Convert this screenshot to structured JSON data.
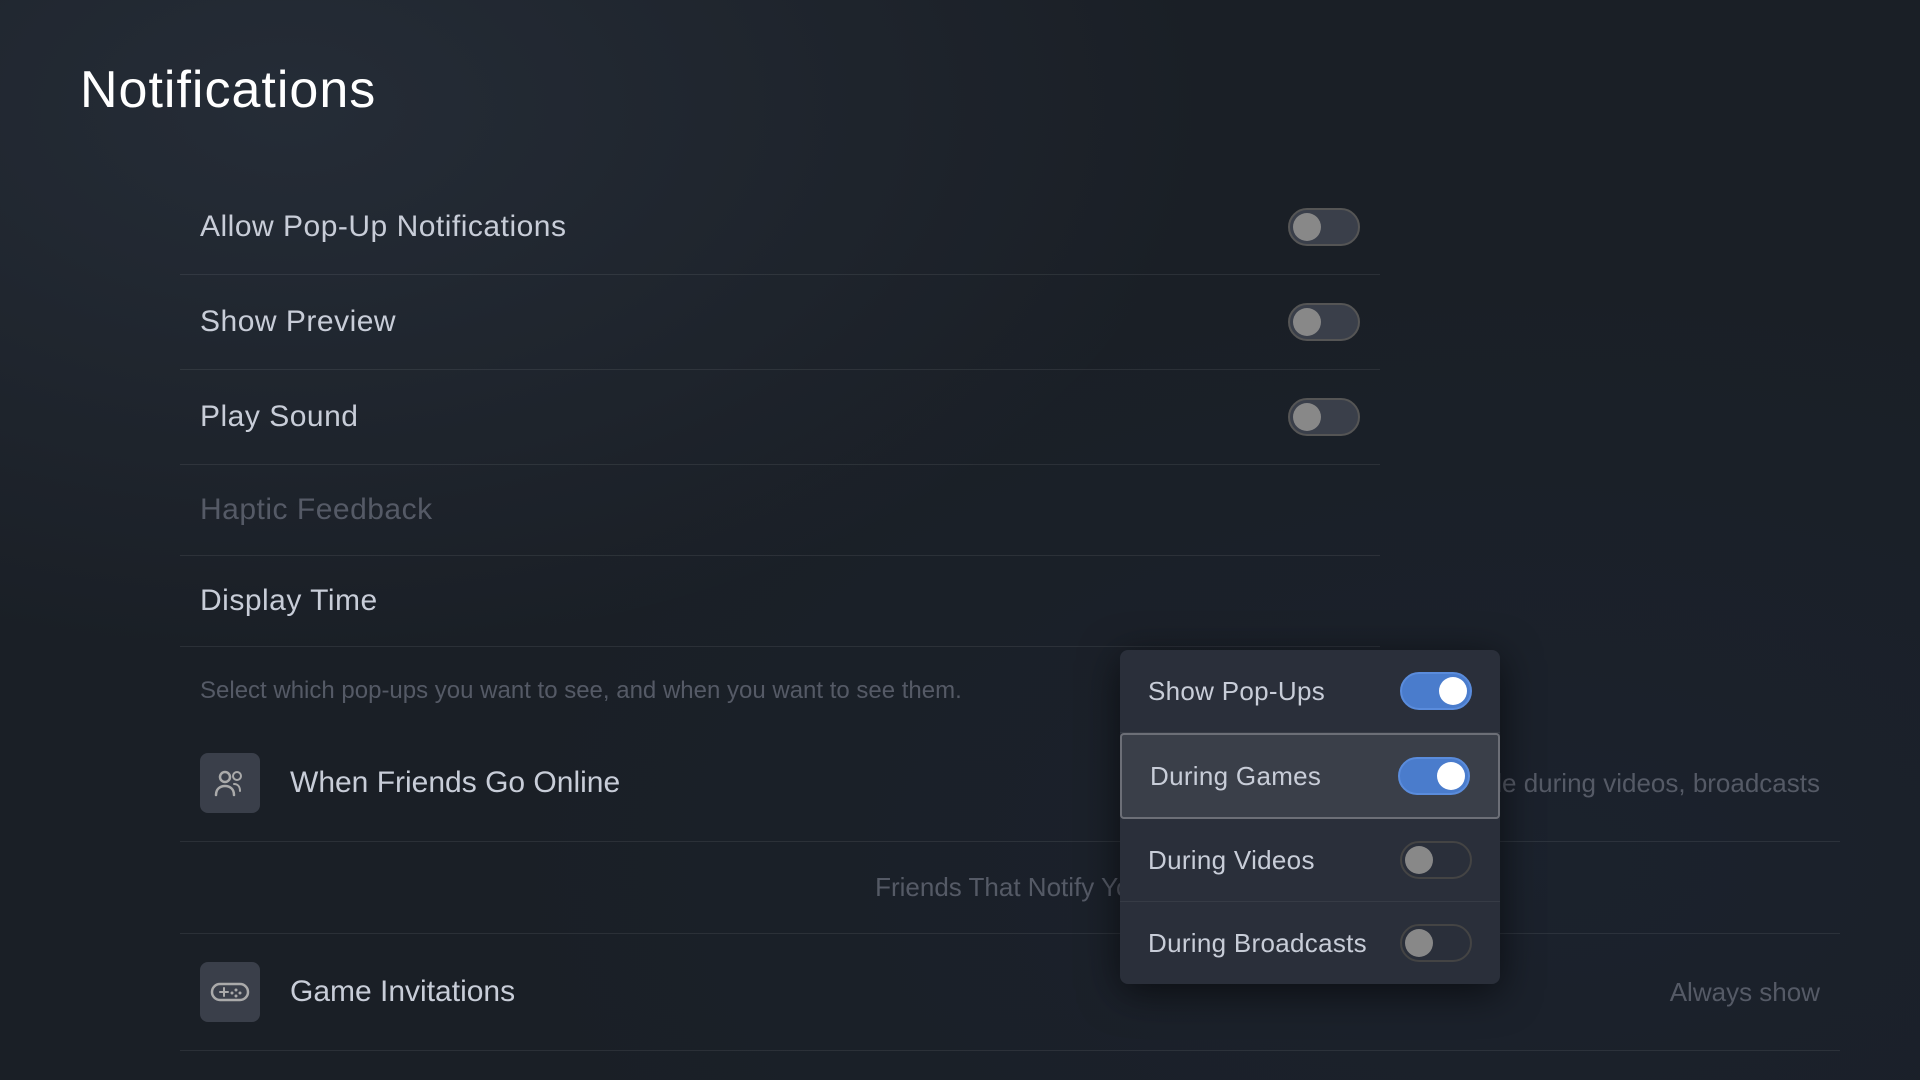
{
  "page": {
    "title": "Notifications"
  },
  "settings": [
    {
      "id": "allow-popups",
      "label": "Allow Pop-Up Notifications",
      "toggle_state": "off",
      "dimmed": false
    },
    {
      "id": "show-preview",
      "label": "Show Preview",
      "toggle_state": "off",
      "dimmed": false
    },
    {
      "id": "play-sound",
      "label": "Play Sound",
      "toggle_state": "off",
      "dimmed": false
    },
    {
      "id": "haptic-feedback",
      "label": "Haptic Feedback",
      "toggle_state": "off",
      "dimmed": true
    },
    {
      "id": "display-time",
      "label": "Display Time",
      "toggle_state": null,
      "dimmed": false
    }
  ],
  "dropdown": {
    "items": [
      {
        "id": "show-popups",
        "label": "Show Pop-Ups",
        "toggle_state": "on",
        "selected": false
      },
      {
        "id": "during-games",
        "label": "During Games",
        "toggle_state": "on",
        "selected": true
      },
      {
        "id": "during-videos",
        "label": "During Videos",
        "toggle_state": "off",
        "selected": false
      },
      {
        "id": "during-broadcasts",
        "label": "During Broadcasts",
        "toggle_state": "off",
        "selected": false
      }
    ]
  },
  "info_text": "Select which pop-ups you want to see, and when you want to see them.",
  "notifications": [
    {
      "id": "friends-online",
      "icon": "friends",
      "label": "When Friends Go Online",
      "status": "Hide during videos, broadcasts"
    },
    {
      "id": "friends-notify",
      "label": "Friends That Notify You",
      "status": null,
      "is_section": true
    },
    {
      "id": "game-invitations",
      "icon": "controller",
      "label": "Game Invitations",
      "status": "Always show"
    }
  ]
}
